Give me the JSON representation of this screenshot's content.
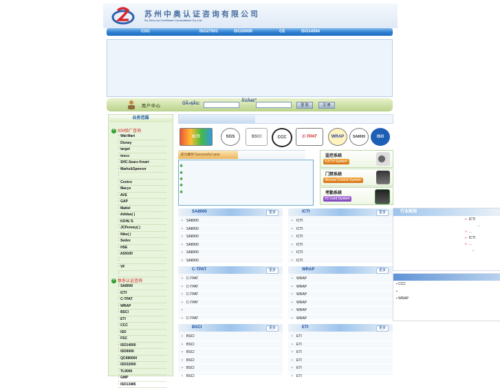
{
  "header": {
    "site_name": "苏州中奥认证咨询有限公司",
    "site_name_en": "Su Zhou Ao Certificate Consultation Co.,Ltd"
  },
  "nav": {
    "items": [
      "COC",
      "ISO27001",
      "ISO20000",
      "CE",
      "ISO14064"
    ]
  },
  "login": {
    "title": "用户中心",
    "user_label": "ÓÃ»§Ãû:",
    "pass_label": "ÃÜÂë£º",
    "buttons": [
      "登 陆",
      "注 册"
    ]
  },
  "sidebar": {
    "heading": "业务范围",
    "cat1": "000验厂咨询",
    "cat1_items": [
      "Wal-Mart",
      "Disney",
      "target",
      "tesco",
      "SHC-Sears Kmart",
      "Marks&Spencer",
      "",
      "Costco",
      "Macys",
      "AVE",
      "GAP",
      "Mattel",
      "Adidas(      )",
      "KOHL'S",
      "JCPenney(      )",
      "Nike(   )",
      "Sedex",
      "HSE",
      "AS9100",
      "",
      "VF",
      "",
      "",
      ""
    ],
    "cat2": "体系认证咨询",
    "cat2_items": [
      "SA8000",
      "ICTI",
      "C-TPAT",
      "WRAP",
      "BSCI",
      "ETI",
      "CCC",
      "ISO",
      "FSC",
      "ISO14000",
      "ISO9000",
      "QC080000",
      "ISO22000",
      "TL9000",
      "GMP",
      "ISO13485"
    ]
  },
  "cert_logos": [
    "ICTI",
    "SGS",
    "BSCI",
    "CCC",
    "C-TPAT",
    "WRAP",
    "SA8000",
    "ISO"
  ],
  "cases": {
    "tag": "成功案例 Successful case",
    "rows": 5
  },
  "systems": [
    {
      "title": "监控系统",
      "sub": "CCTV System"
    },
    {
      "title": "门禁系统",
      "sub": "Access Control System"
    },
    {
      "title": "考勤系统",
      "sub": "IC Card System"
    }
  ],
  "panels": [
    {
      "title": "SA8000",
      "more": "更多",
      "items": [
        "SA8000",
        "SA8000",
        "SA8000",
        "SA8000",
        "SA8000",
        "SA8000"
      ]
    },
    {
      "title": "ICTI",
      "more": "更多",
      "items": [
        "ICTI",
        "ICTI",
        "ICTI",
        "ICTI",
        "ICTI",
        "ICTI"
      ]
    },
    {
      "title": "C-TPAT",
      "more": "更多",
      "items": [
        "C-TPAT",
        "C-TPAT",
        "C-TPAT",
        "C-TPAT",
        "",
        "C-TPAT"
      ]
    },
    {
      "title": "WRAP",
      "more": "更多",
      "items": [
        "WRAP",
        "WRAP",
        "WRAP",
        "WRAP",
        "WRAP",
        "WRAP"
      ]
    },
    {
      "title": "BSCI",
      "more": "更多",
      "items": [
        "BSCI",
        "BSCI",
        "BSCI",
        "BSCI",
        "BSCI",
        "BSCI"
      ]
    },
    {
      "title": "ETI",
      "more": "更多",
      "items": [
        "ETI",
        "ETI",
        "ETI",
        "ETI",
        "ETI",
        "ETI"
      ]
    }
  ],
  "right_news": {
    "title": "行业新闻",
    "items": [
      "ICTI",
      "...",
      "...",
      "...",
      "ICTI",
      "..."
    ]
  },
  "right_list": {
    "items": [
      "CCC",
      "",
      "WRAP"
    ]
  }
}
